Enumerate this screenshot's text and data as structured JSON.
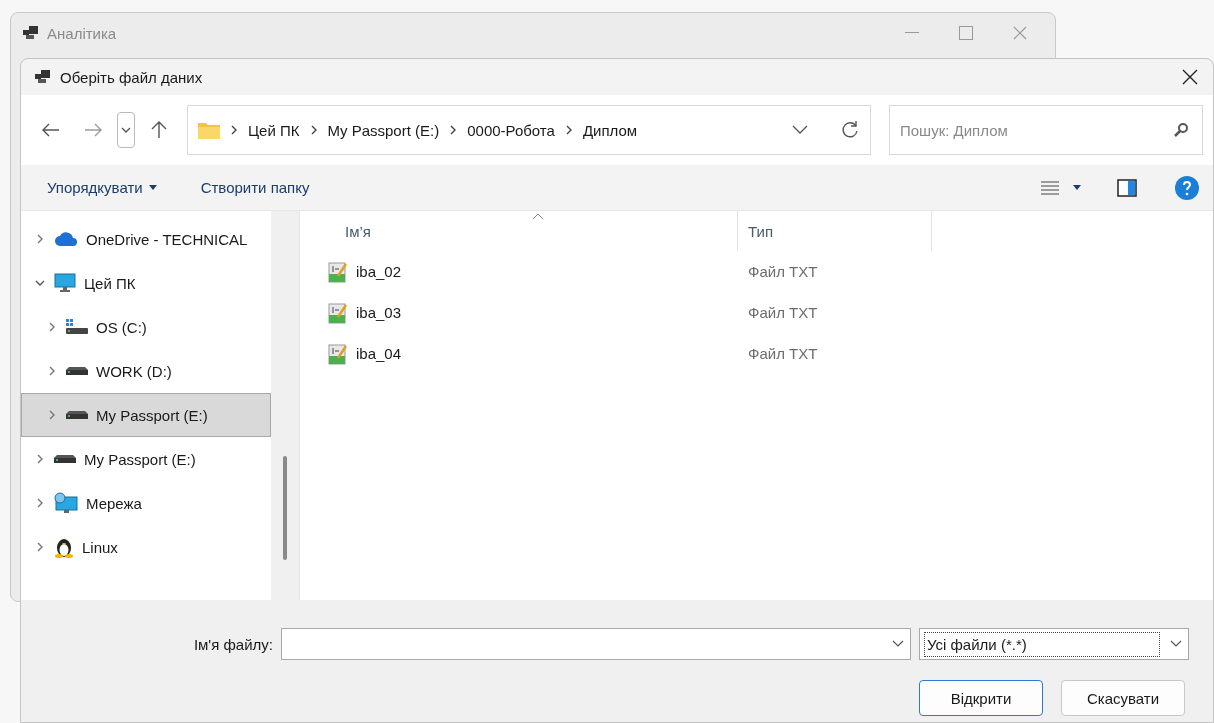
{
  "parent_window": {
    "title": "Аналітика"
  },
  "dialog": {
    "title": "Оберіть файл даних"
  },
  "address_bar": {
    "path": [
      "Цей ПК",
      "My Passport (E:)",
      "0000-Робота",
      "Диплом"
    ]
  },
  "search": {
    "placeholder": "Пошук: Диплом"
  },
  "toolbar": {
    "organize": "Упорядкувати",
    "new_folder": "Створити папку"
  },
  "navigation": [
    {
      "label": "OneDrive - TECHNICAL",
      "kind": "cloud",
      "expanded": false,
      "selected": false
    },
    {
      "label": "Цей ПК",
      "kind": "computer",
      "expanded": true,
      "selected": false,
      "children": [
        {
          "label": "OS (C:)",
          "kind": "system-drive",
          "expanded": false,
          "selected": false
        },
        {
          "label": "WORK (D:)",
          "kind": "drive",
          "expanded": false,
          "selected": false
        },
        {
          "label": "My Passport (E:)",
          "kind": "drive",
          "expanded": false,
          "selected": true
        }
      ]
    },
    {
      "label": "My Passport (E:)",
      "kind": "drive",
      "expanded": false,
      "selected": false
    },
    {
      "label": "Мережа",
      "kind": "network",
      "expanded": false,
      "selected": false
    },
    {
      "label": "Linux",
      "kind": "linux",
      "expanded": false,
      "selected": false
    }
  ],
  "file_list": {
    "columns": [
      "Ім’я",
      "Тип"
    ],
    "rows": [
      {
        "name": "iba_02",
        "type": "Файл TXT"
      },
      {
        "name": "iba_03",
        "type": "Файл TXT"
      },
      {
        "name": "iba_04",
        "type": "Файл TXT"
      }
    ]
  },
  "footer": {
    "file_name_label": "Ім'я файлу:",
    "filter": "Усі файли (*.*)",
    "open": "Відкрити",
    "cancel": "Скасувати"
  }
}
